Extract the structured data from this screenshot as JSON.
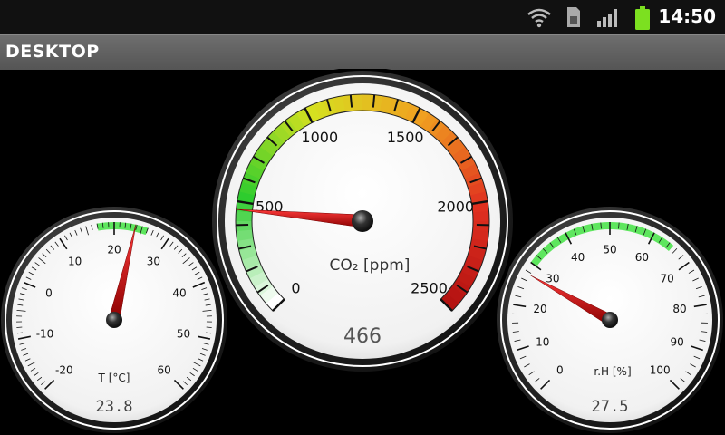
{
  "status_bar": {
    "time": "14:50",
    "icons": [
      "wifi-icon",
      "sim-card-icon",
      "signal-icon",
      "battery-icon"
    ]
  },
  "app": {
    "title": "DESKTOP"
  },
  "gauges": {
    "temperature": {
      "label": "T [°C]",
      "value": 23.8,
      "value_text": "23.8",
      "min": -20,
      "max": 60,
      "ticks": [
        "-20",
        "-10",
        "0",
        "10",
        "20",
        "30",
        "40",
        "50",
        "60"
      ],
      "green_band": [
        17,
        26
      ],
      "needle_color": "#cc1111"
    },
    "co2": {
      "label": "CO₂ [ppm]",
      "value": 466,
      "value_text": "466",
      "min": 0,
      "max": 2500,
      "ticks": [
        "0",
        "500",
        "1000",
        "1500",
        "2000",
        "2500"
      ],
      "color_band": [
        "#ffffff",
        "#2ecc2e",
        "#d6e020",
        "#f0a020",
        "#e03020",
        "#b01010"
      ],
      "needle_color": "#cc1111"
    },
    "humidity": {
      "label": "r.H [%]",
      "value": 27.5,
      "value_text": "27.5",
      "min": 0,
      "max": 100,
      "ticks": [
        "0",
        "10",
        "20",
        "30",
        "40",
        "50",
        "60",
        "70",
        "80",
        "90",
        "100"
      ],
      "green_band": [
        30,
        65
      ],
      "needle_color": "#cc1111"
    }
  }
}
